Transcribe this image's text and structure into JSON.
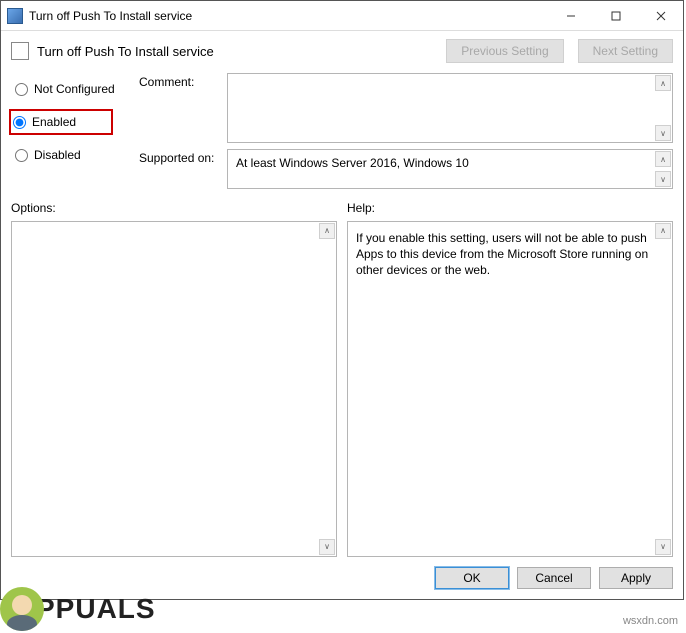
{
  "window": {
    "title": "Turn off Push To Install service"
  },
  "header": {
    "title": "Turn off Push To Install service",
    "prev": "Previous Setting",
    "next": "Next Setting"
  },
  "radios": {
    "not_configured": "Not Configured",
    "enabled": "Enabled",
    "disabled": "Disabled",
    "selected": "enabled"
  },
  "fields": {
    "comment_label": "Comment:",
    "comment_value": "",
    "supported_label": "Supported on:",
    "supported_value": "At least Windows Server 2016, Windows 10"
  },
  "sections": {
    "options_label": "Options:",
    "help_label": "Help:",
    "options_text": "",
    "help_text": "If you enable this setting, users will not be able to push Apps to this device from the Microsoft Store running on other devices or the web."
  },
  "buttons": {
    "ok": "OK",
    "cancel": "Cancel",
    "apply": "Apply"
  },
  "watermark": {
    "brand": "PPUALS",
    "site": "wsxdn.com"
  }
}
